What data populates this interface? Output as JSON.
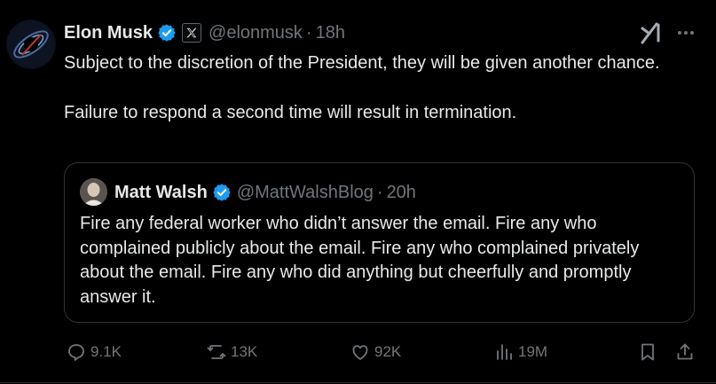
{
  "post": {
    "author": {
      "name": "Elon Musk",
      "handle": "@elonmusk",
      "verified": true,
      "affiliation_badge": "x-logo-icon"
    },
    "separator": "·",
    "time": "18h",
    "text_paragraphs": [
      "Subject to the discretion of the President, they will be given another chance.",
      "Failure to respond a second time will result in termination."
    ]
  },
  "quoted_post": {
    "author": {
      "name": "Matt Walsh",
      "handle": "@MattWalshBlog",
      "verified": true
    },
    "separator": "·",
    "time": "20h",
    "text": "Fire any federal worker who didn’t answer the email. Fire any who complained publicly about the email. Fire any who complained privately about the email. Fire any who did anything but cheerfully and promptly answer it."
  },
  "actions": {
    "replies": "9.1K",
    "reposts": "13K",
    "likes": "92K",
    "views": "19M"
  },
  "colors": {
    "background": "#000000",
    "text": "#e7e9ea",
    "secondary_text": "#71767b",
    "border": "#2f3336",
    "verified_blue": "#1d9bf0"
  },
  "icons": [
    "grok-icon",
    "more-icon",
    "verified-badge-icon",
    "reply-icon",
    "repost-icon",
    "like-icon",
    "views-icon",
    "bookmark-icon",
    "share-icon"
  ]
}
